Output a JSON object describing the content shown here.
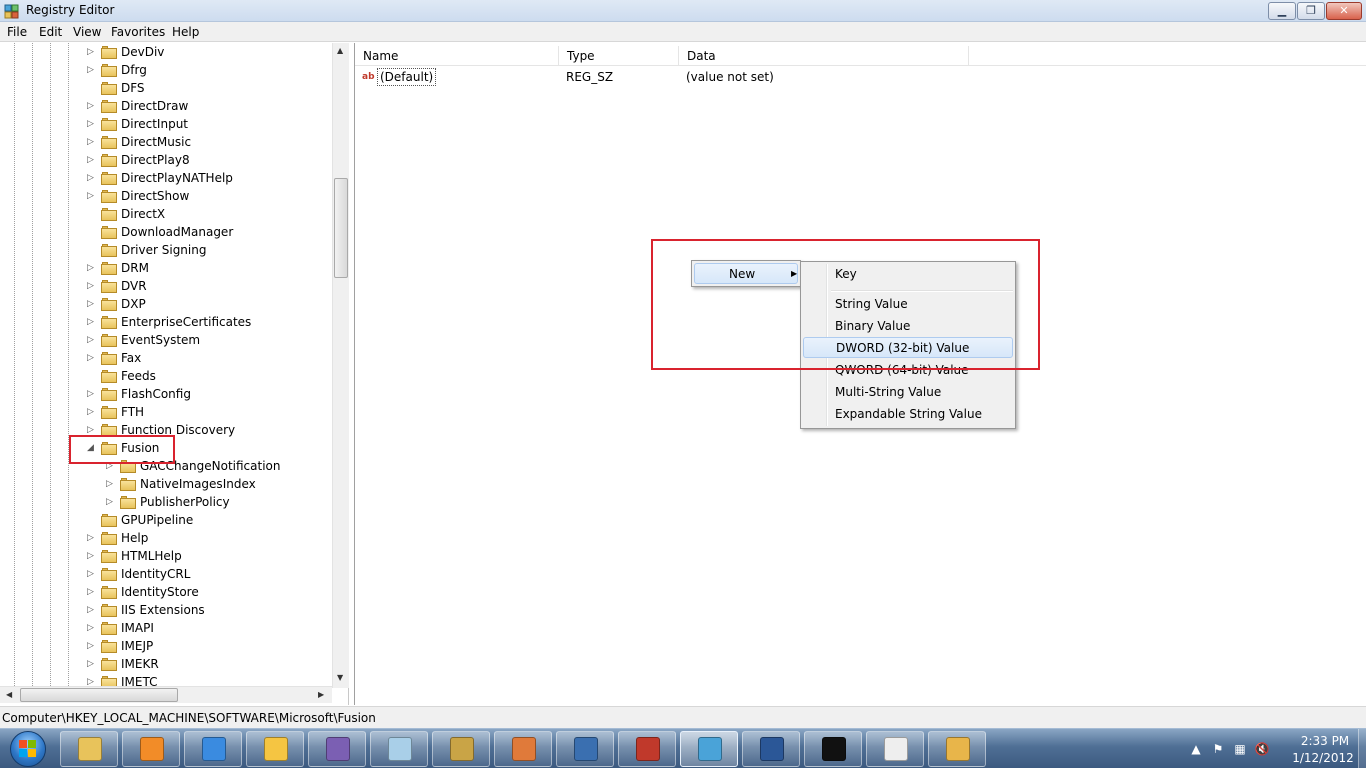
{
  "window": {
    "title": "Registry Editor",
    "minimize_icon": "minimize-glyph",
    "maximize_icon": "restore-glyph",
    "close_icon": "close-glyph"
  },
  "menu": [
    "File",
    "Edit",
    "View",
    "Favorites",
    "Help"
  ],
  "tree": {
    "items": [
      {
        "label": "DevDiv",
        "expander": "collapsed"
      },
      {
        "label": "Dfrg",
        "expander": "collapsed"
      },
      {
        "label": "DFS",
        "expander": "none"
      },
      {
        "label": "DirectDraw",
        "expander": "collapsed"
      },
      {
        "label": "DirectInput",
        "expander": "collapsed"
      },
      {
        "label": "DirectMusic",
        "expander": "collapsed"
      },
      {
        "label": "DirectPlay8",
        "expander": "collapsed"
      },
      {
        "label": "DirectPlayNATHelp",
        "expander": "collapsed"
      },
      {
        "label": "DirectShow",
        "expander": "collapsed"
      },
      {
        "label": "DirectX",
        "expander": "none"
      },
      {
        "label": "DownloadManager",
        "expander": "none"
      },
      {
        "label": "Driver Signing",
        "expander": "none"
      },
      {
        "label": "DRM",
        "expander": "collapsed"
      },
      {
        "label": "DVR",
        "expander": "collapsed"
      },
      {
        "label": "DXP",
        "expander": "collapsed"
      },
      {
        "label": "EnterpriseCertificates",
        "expander": "collapsed"
      },
      {
        "label": "EventSystem",
        "expander": "collapsed"
      },
      {
        "label": "Fax",
        "expander": "collapsed"
      },
      {
        "label": "Feeds",
        "expander": "none"
      },
      {
        "label": "FlashConfig",
        "expander": "collapsed"
      },
      {
        "label": "FTH",
        "expander": "collapsed"
      },
      {
        "label": "Function Discovery",
        "expander": "collapsed"
      },
      {
        "label": "Fusion",
        "expander": "expanded",
        "selected": true
      },
      {
        "label": "GACChangeNotification",
        "expander": "collapsed",
        "child": true
      },
      {
        "label": "NativeImagesIndex",
        "expander": "collapsed",
        "child": true
      },
      {
        "label": "PublisherPolicy",
        "expander": "collapsed",
        "child": true
      },
      {
        "label": "GPUPipeline",
        "expander": "none"
      },
      {
        "label": "Help",
        "expander": "collapsed"
      },
      {
        "label": "HTMLHelp",
        "expander": "collapsed"
      },
      {
        "label": "IdentityCRL",
        "expander": "collapsed"
      },
      {
        "label": "IdentityStore",
        "expander": "collapsed"
      },
      {
        "label": "IIS Extensions",
        "expander": "collapsed"
      },
      {
        "label": "IMAPI",
        "expander": "collapsed"
      },
      {
        "label": "IMEJP",
        "expander": "collapsed"
      },
      {
        "label": "IMEKR",
        "expander": "collapsed"
      },
      {
        "label": "IMETC",
        "expander": "collapsed"
      }
    ]
  },
  "list": {
    "columns": [
      "Name",
      "Type",
      "Data"
    ],
    "rows": [
      {
        "name": "(Default)",
        "type": "REG_SZ",
        "data": "(value not set)",
        "icon": "ab-string-icon"
      }
    ]
  },
  "context_menu": {
    "new_label": "New",
    "submenu": [
      {
        "label": "Key"
      },
      {
        "label": "String Value"
      },
      {
        "label": "Binary Value"
      },
      {
        "label": "DWORD (32-bit) Value",
        "hover": true
      },
      {
        "label": "QWORD (64-bit) Value"
      },
      {
        "label": "Multi-String Value"
      },
      {
        "label": "Expandable String Value"
      }
    ]
  },
  "statusbar": {
    "path": "Computer\\HKEY_LOCAL_MACHINE\\SOFTWARE\\Microsoft\\Fusion"
  },
  "taskbar": {
    "apps": [
      {
        "name": "windows-explorer-icon",
        "color": "#e8c35b"
      },
      {
        "name": "media-player-icon",
        "color": "#f28c28"
      },
      {
        "name": "internet-explorer-icon",
        "color": "#3a8be0"
      },
      {
        "name": "outlook-icon",
        "color": "#f5c542"
      },
      {
        "name": "visual-studio-icon",
        "color": "#7b5fb3"
      },
      {
        "name": "notepad-icon",
        "color": "#a9cfe8"
      },
      {
        "name": "tools-icon",
        "color": "#c9a446"
      },
      {
        "name": "paint-tools-icon",
        "color": "#e07a3a"
      },
      {
        "name": "remote-computer-icon",
        "color": "#3a6fb0"
      },
      {
        "name": "toolbox-icon",
        "color": "#c0392b"
      },
      {
        "name": "registry-editor-icon",
        "color": "#4aa3d8"
      },
      {
        "name": "word-icon",
        "color": "#2b5797"
      },
      {
        "name": "command-prompt-icon",
        "color": "#111111"
      },
      {
        "name": "document-icon",
        "color": "#eeeeee"
      },
      {
        "name": "paint-icon",
        "color": "#e8b54a"
      }
    ],
    "clock_time": "2:33 PM",
    "clock_date": "1/12/2012",
    "tray_icons": [
      "show-hidden-icons-icon",
      "flag-icon",
      "network-icon",
      "volume-muted-icon"
    ]
  },
  "colors": {
    "highlight_border": "#d9232e",
    "menu_hover": "#d7e7f9",
    "folder": "#e8c35b"
  }
}
